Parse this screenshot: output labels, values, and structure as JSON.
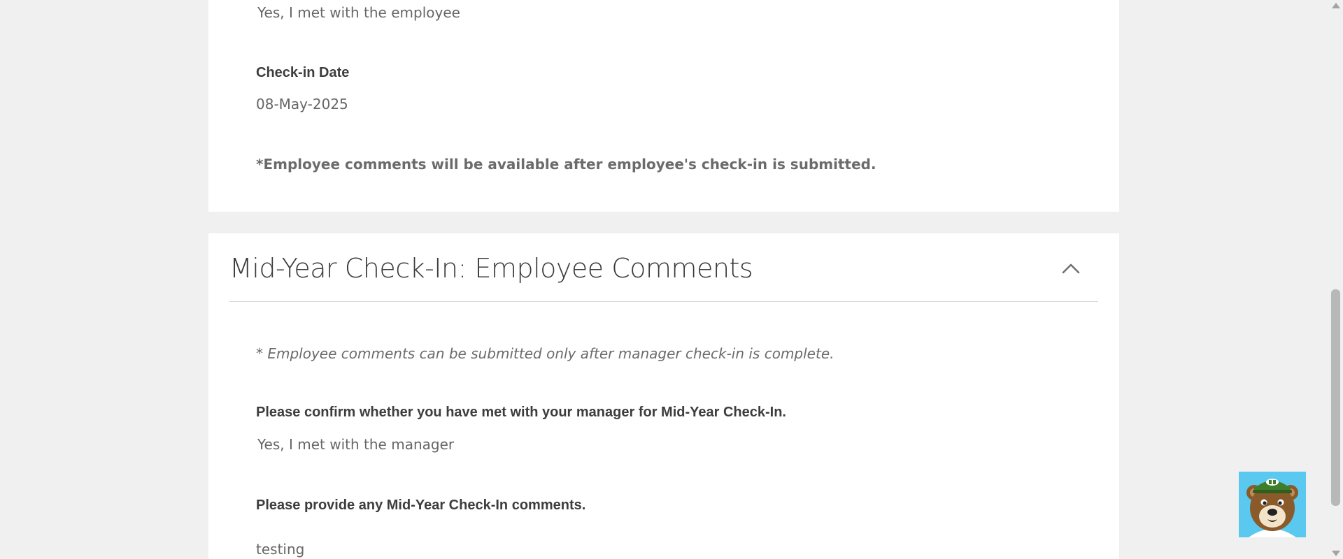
{
  "manager_section": {
    "met_answer": "Yes, I met with the employee",
    "checkin_date_label": "Check-in Date",
    "checkin_date_value": "08-May-2025",
    "employee_note": "*Employee comments will be available after employee's check-in is submitted."
  },
  "employee_section": {
    "title": "Mid-Year Check-In: Employee Comments",
    "note": "* Employee comments can be submitted only after manager check-in is complete.",
    "confirm_question": "Please confirm whether you have met with your manager for Mid-Year Check-In.",
    "confirm_answer": "Yes, I met with the manager",
    "comments_question": "Please provide any Mid-Year Check-In comments.",
    "comments_answer": "testing"
  },
  "icons": {
    "collapse": "chevron-up-icon",
    "chat": "bear-mascot-icon"
  },
  "colors": {
    "page_bg": "#f0f0f0",
    "card_bg": "#ffffff",
    "mascot_bg": "#5ac8ef"
  }
}
